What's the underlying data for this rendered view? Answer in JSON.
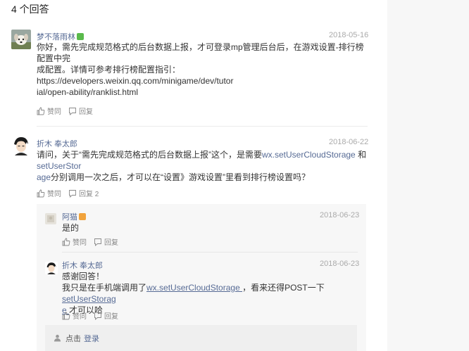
{
  "header": {
    "answers_count_label": "4 个回答"
  },
  "answers": [
    {
      "user": "梦不落雨林",
      "date": "2018-05-16",
      "content_lines": [
        "你好，需先完成规范格式的后台数据上报，才可登录mp管理后台后，在游戏设置-排行榜配置中完",
        "成配置。详情可参考排行榜配置指引：https://developers.weixin.qq.com/minigame/dev/tutor",
        "ial/open-ability/ranklist.html"
      ],
      "like_label": "赞同",
      "reply_label": "回复"
    },
    {
      "user": "折木 奉太郎",
      "date": "2018-06-22",
      "content": {
        "p1": "请问，关于“需先完成规范格式的后台数据上报”这个，是需要",
        "link1": "wx.setUserCloudStorage",
        "p2": " 和",
        "link2a": "setUserStor",
        "link2b": "age",
        "p3": "分别调用一次之后，才可以在“设置》游戏设置”里看到排行榜设置吗？"
      },
      "like_label": "赞同",
      "reply_label": "回复 2"
    }
  ],
  "replies": [
    {
      "user": "阿猫",
      "date": "2018-06-23",
      "content": "是的",
      "like_label": "赞同",
      "reply_label": "回复"
    },
    {
      "user": "折木 奉太郎",
      "date": "2018-06-23",
      "content": {
        "line1": "感谢回答！",
        "p1": "我只是在手机端调用了",
        "link1": "wx.setUserCloudStorage ",
        "p2": "，看来还得POST一下",
        "link2a": "setUserStorag",
        "link2b": "e ",
        "p3": "才可以哈"
      },
      "like_label": "赞同",
      "reply_label": "回复"
    }
  ],
  "login_bar": {
    "prefix": "点击",
    "link": "登录"
  },
  "colors": {
    "link": "#576b95",
    "badge_green": "#5aba4c",
    "badge_orange": "#f1a33c",
    "muted": "#888888"
  }
}
